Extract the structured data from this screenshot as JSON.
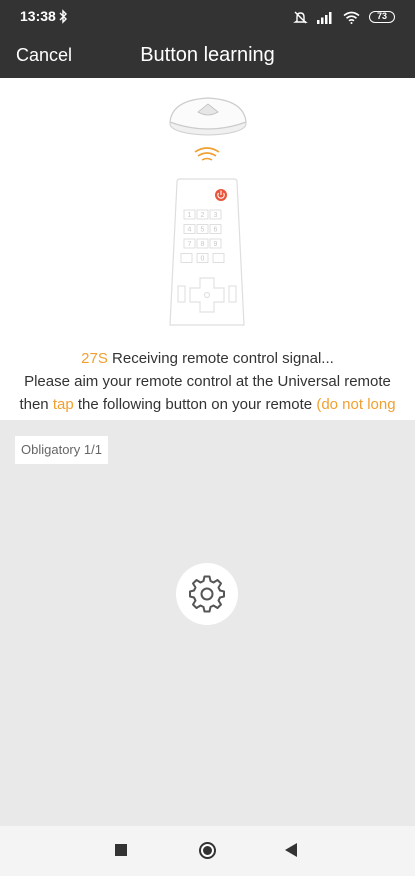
{
  "status_bar": {
    "time": "13:38",
    "battery": "73",
    "icons": [
      "bluetooth-icon",
      "alarm-off-icon",
      "signal-icon",
      "wifi-icon",
      "battery-icon"
    ]
  },
  "header": {
    "cancel_label": "Cancel",
    "title": "Button learning"
  },
  "illustration": {
    "keypad": [
      "1",
      "2",
      "3",
      "4",
      "5",
      "6",
      "7",
      "8",
      "9",
      "",
      "0",
      ""
    ]
  },
  "message": {
    "countdown": "27S",
    "receiving": " Receiving remote control signal...",
    "line2": "Please aim your remote control at the Universal remote",
    "line3_start": "then ",
    "line3_tap": "tap",
    "line3_middle": " the following button on your remote ",
    "line3_hint": "(do not long"
  },
  "panel": {
    "tag": "Obligatory 1/1",
    "button_icon": "gear-icon"
  },
  "colors": {
    "bar": "#333333",
    "accent": "#f0a030",
    "panel": "#e9e9e9",
    "power": "#e8553a"
  },
  "nav": {
    "icons": [
      "recent-apps-icon",
      "home-icon",
      "back-icon"
    ]
  }
}
